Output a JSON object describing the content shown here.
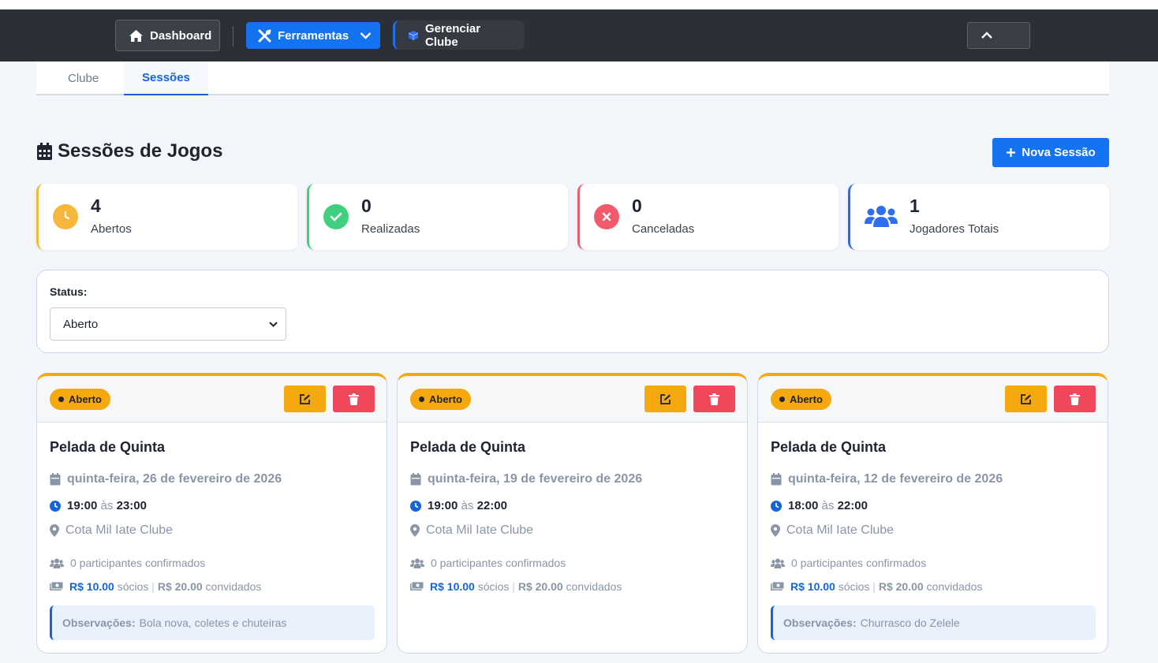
{
  "nav": {
    "dashboard_label": "Dashboard",
    "tools_label": "Ferramentas",
    "manage_label": "Gerenciar Clube"
  },
  "tabs": [
    {
      "label": "Clube",
      "active": false
    },
    {
      "label": "Sessões",
      "active": true
    }
  ],
  "page": {
    "title": "Sessões de Jogos",
    "new_button": "Nova Sessão"
  },
  "stats": [
    {
      "value": "4",
      "label": "Abertos",
      "color": "#f6b73c"
    },
    {
      "value": "0",
      "label": "Realizadas",
      "color": "#3fcf7f"
    },
    {
      "value": "0",
      "label": "Canceladas",
      "color": "#f05a6b"
    },
    {
      "value": "1",
      "label": "Jogadores Totais",
      "color": "#1e6ff5"
    }
  ],
  "filter": {
    "label": "Status:",
    "selected": "Aberto"
  },
  "sessions": [
    {
      "status": "Aberto",
      "title": "Pelada de Quinta",
      "date": "quinta-feira, 26 de fevereiro de 2026",
      "start": "19:00",
      "sep": "às",
      "end": "23:00",
      "location": "Cota Mil Iate Clube",
      "participants": "0 participantes confirmados",
      "price_members": "R$ 10.00",
      "members_label": "sócios",
      "price_guests": "R$ 20.00",
      "guests_label": "convidados",
      "notes_label": "Observações:",
      "notes": "Bola nova, coletes e chuteiras"
    },
    {
      "status": "Aberto",
      "title": "Pelada de Quinta",
      "date": "quinta-feira, 19 de fevereiro de 2026",
      "start": "19:00",
      "sep": "às",
      "end": "22:00",
      "location": "Cota Mil Iate Clube",
      "participants": "0 participantes confirmados",
      "price_members": "R$ 10.00",
      "members_label": "sócios",
      "price_guests": "R$ 20.00",
      "guests_label": "convidados"
    },
    {
      "status": "Aberto",
      "title": "Pelada de Quinta",
      "date": "quinta-feira, 12 de fevereiro de 2026",
      "start": "18:00",
      "sep": "às",
      "end": "22:00",
      "location": "Cota Mil Iate Clube",
      "participants": "0 participantes confirmados",
      "price_members": "R$ 10.00",
      "members_label": "sócios",
      "price_guests": "R$ 20.00",
      "guests_label": "convidados",
      "notes_label": "Observações:",
      "notes": "Churrasco do Zelele"
    }
  ]
}
